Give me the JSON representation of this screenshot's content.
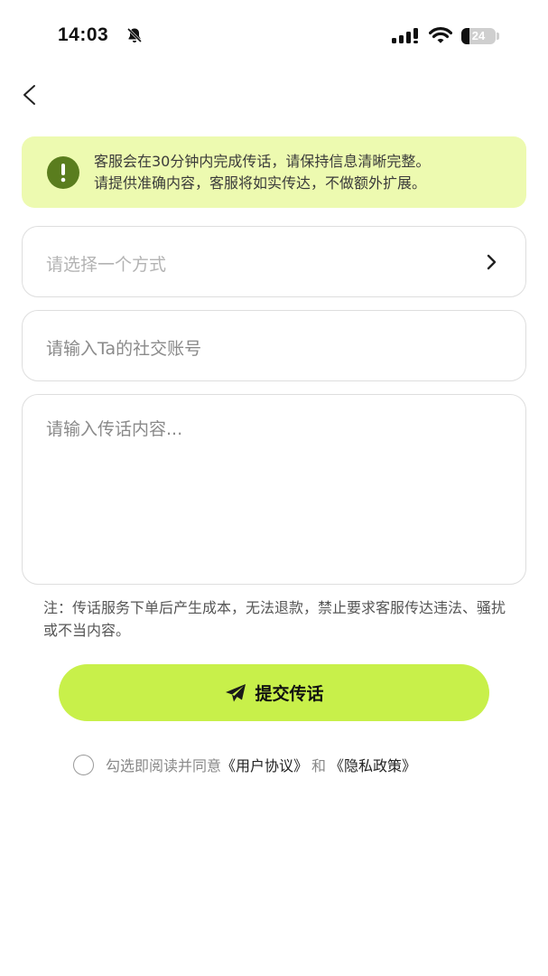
{
  "status_bar": {
    "time": "14:03",
    "battery": "24",
    "battery_level": 0.24
  },
  "icons": {
    "bell": "bell-off-icon",
    "signal": "signal-icon",
    "wifi": "wifi-icon",
    "back": "chevron-left-icon",
    "warning": "exclamation-circle-icon",
    "chevron": "chevron-right-icon",
    "send": "paper-plane-icon"
  },
  "colors": {
    "accent": "#c8f04a",
    "notice_bg": "#edfab0",
    "notice_icon": "#5a7d1e"
  },
  "notice": {
    "line1": "客服会在30分钟内完成传话，请保持信息清晰完整。",
    "line2": "请提供准确内容，客服将如实传达，不做额外扩展。"
  },
  "form": {
    "method_placeholder": "请选择一个方式",
    "account_placeholder": "请输入Ta的社交账号",
    "content_placeholder": "请输入传话内容..."
  },
  "note": "注：传话服务下单后产生成本，无法退款，禁止要求客服传达违法、骚扰或不当内容。",
  "submit_label": "提交传话",
  "agreement": {
    "prefix": "勾选即阅读并同意",
    "user_agreement": "《用户协议》",
    "and": "和",
    "privacy_policy": "《隐私政策》"
  }
}
